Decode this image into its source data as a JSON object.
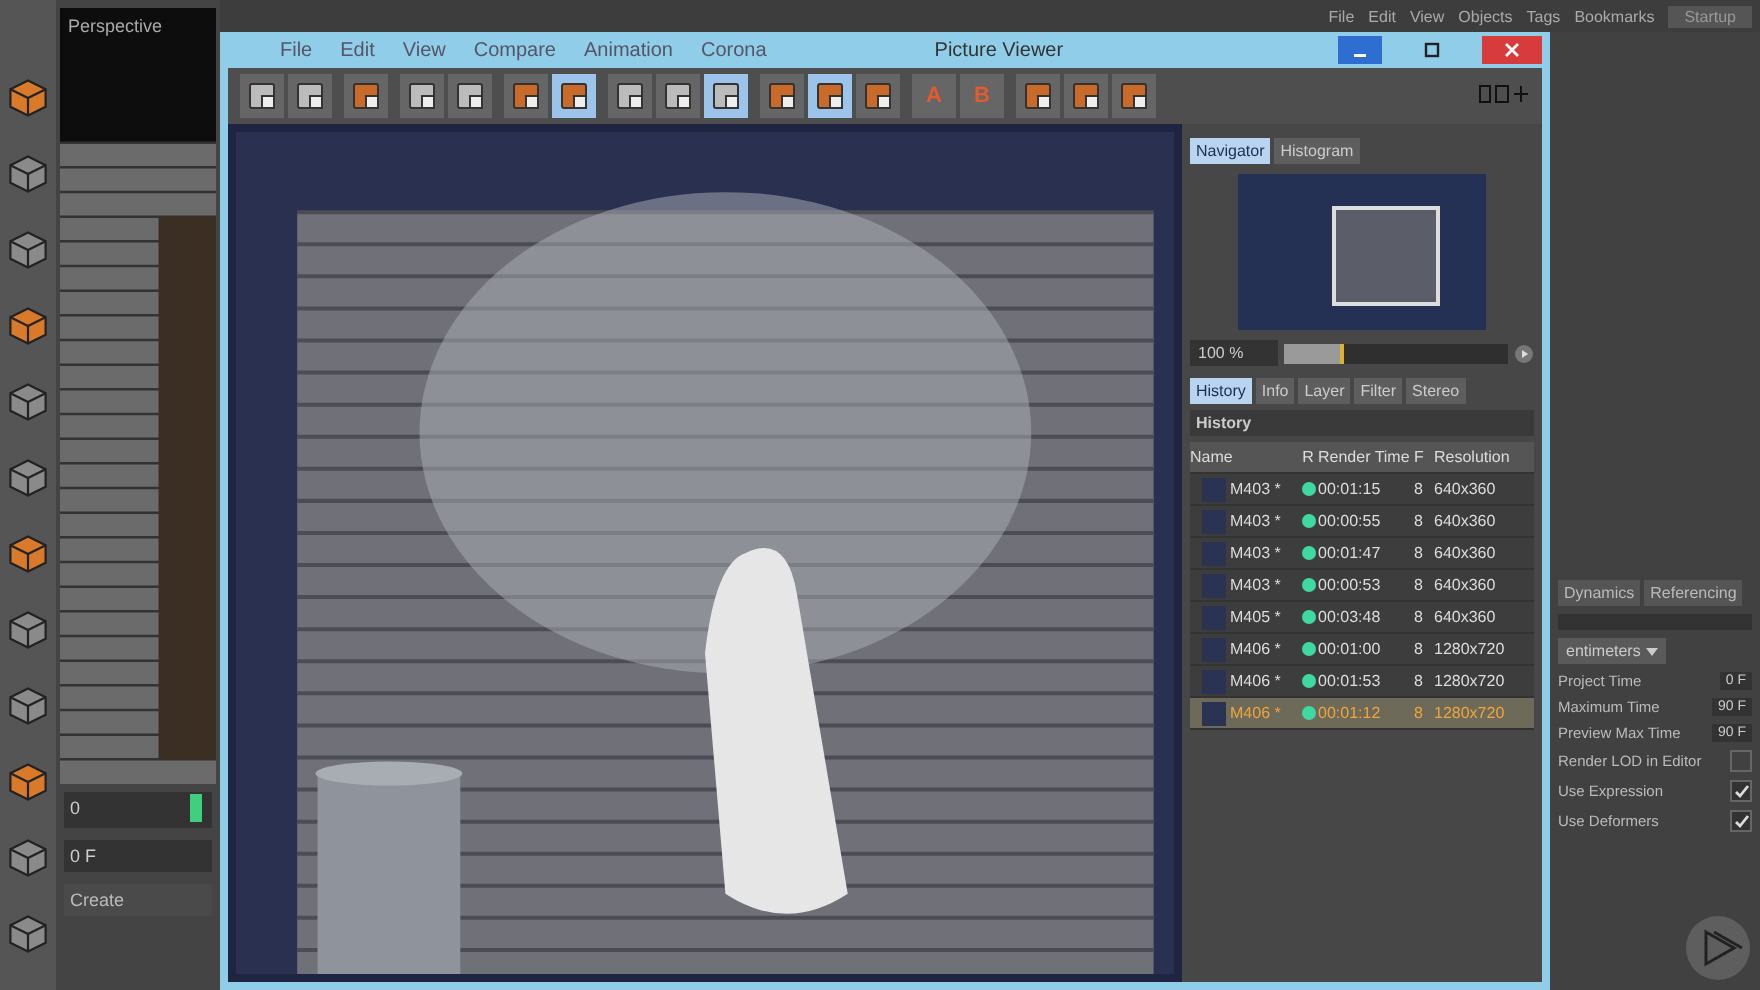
{
  "app_menu": {
    "items": [
      "File",
      "Edit",
      "View",
      "Objects",
      "Tags",
      "Bookmarks"
    ],
    "layout": "Startup"
  },
  "viewport": {
    "title": "Perspective",
    "timeline": {
      "start": "0",
      "level": 0.95
    },
    "frame_field": "0 F",
    "create_button": "Create"
  },
  "window": {
    "title": "Picture Viewer",
    "menu": [
      "File",
      "Edit",
      "View",
      "Compare",
      "Animation",
      "Corona"
    ]
  },
  "toolbar": [
    {
      "buttons": [
        {
          "selected": false
        },
        {
          "selected": false
        }
      ]
    },
    {
      "buttons": [
        {
          "selected": false
        }
      ]
    },
    {
      "buttons": [
        {
          "selected": false
        },
        {
          "selected": false
        }
      ]
    },
    {
      "buttons": [
        {
          "selected": false
        },
        {
          "selected": true
        }
      ]
    },
    {
      "buttons": [
        {
          "selected": false
        },
        {
          "selected": false
        },
        {
          "selected": true
        }
      ]
    },
    {
      "buttons": [
        {
          "selected": false
        },
        {
          "selected": true
        },
        {
          "selected": false
        }
      ]
    },
    {
      "buttons": [
        {
          "selected": false,
          "label": "A"
        },
        {
          "selected": false,
          "label": "B"
        }
      ]
    },
    {
      "buttons": [
        {
          "selected": false
        },
        {
          "selected": false
        },
        {
          "selected": false
        }
      ]
    }
  ],
  "navigator": {
    "tabs": [
      {
        "label": "Navigator",
        "selected": true
      },
      {
        "label": "Histogram",
        "selected": false
      }
    ],
    "zoom": "100 %",
    "zoom_slider": {
      "level": 0.27
    }
  },
  "history": {
    "tabs": [
      {
        "label": "History",
        "selected": true
      },
      {
        "label": "Info",
        "selected": false
      },
      {
        "label": "Layer",
        "selected": false
      },
      {
        "label": "Filter",
        "selected": false
      },
      {
        "label": "Stereo",
        "selected": false
      }
    ],
    "title": "History",
    "columns": [
      "Name",
      "R",
      "Render Time",
      "F",
      "Resolution"
    ],
    "rows": [
      {
        "name": "M403 *",
        "time": "00:01:15",
        "f": "8",
        "resolution": "640x360",
        "selected": false
      },
      {
        "name": "M403 *",
        "time": "00:00:55",
        "f": "8",
        "resolution": "640x360",
        "selected": false
      },
      {
        "name": "M403 *",
        "time": "00:01:47",
        "f": "8",
        "resolution": "640x360",
        "selected": false
      },
      {
        "name": "M403 *",
        "time": "00:00:53",
        "f": "8",
        "resolution": "640x360",
        "selected": false
      },
      {
        "name": "M405 *",
        "time": "00:03:48",
        "f": "8",
        "resolution": "640x360",
        "selected": false
      },
      {
        "name": "M406 *",
        "time": "00:01:00",
        "f": "8",
        "resolution": "1280x720",
        "selected": false
      },
      {
        "name": "M406 *",
        "time": "00:01:53",
        "f": "8",
        "resolution": "1280x720",
        "selected": false
      },
      {
        "name": "M406 *",
        "time": "00:01:12",
        "f": "8",
        "resolution": "1280x720",
        "selected": true
      }
    ]
  },
  "attributes": {
    "tabs": [
      {
        "label": "Dynamics",
        "selected": false
      },
      {
        "label": "Referencing",
        "selected": false
      }
    ],
    "unit": "entimeters",
    "fields": [
      {
        "label": "Project Time",
        "value": "0 F"
      },
      {
        "label": "Maximum Time",
        "value": "90 F"
      },
      {
        "label": "Preview Max Time",
        "value": "90 F"
      }
    ],
    "checks": [
      {
        "label": "Render LOD in Editor",
        "checked": false
      },
      {
        "label": "Use Expression",
        "checked": true
      },
      {
        "label": "Use Deformers",
        "checked": true
      }
    ]
  }
}
